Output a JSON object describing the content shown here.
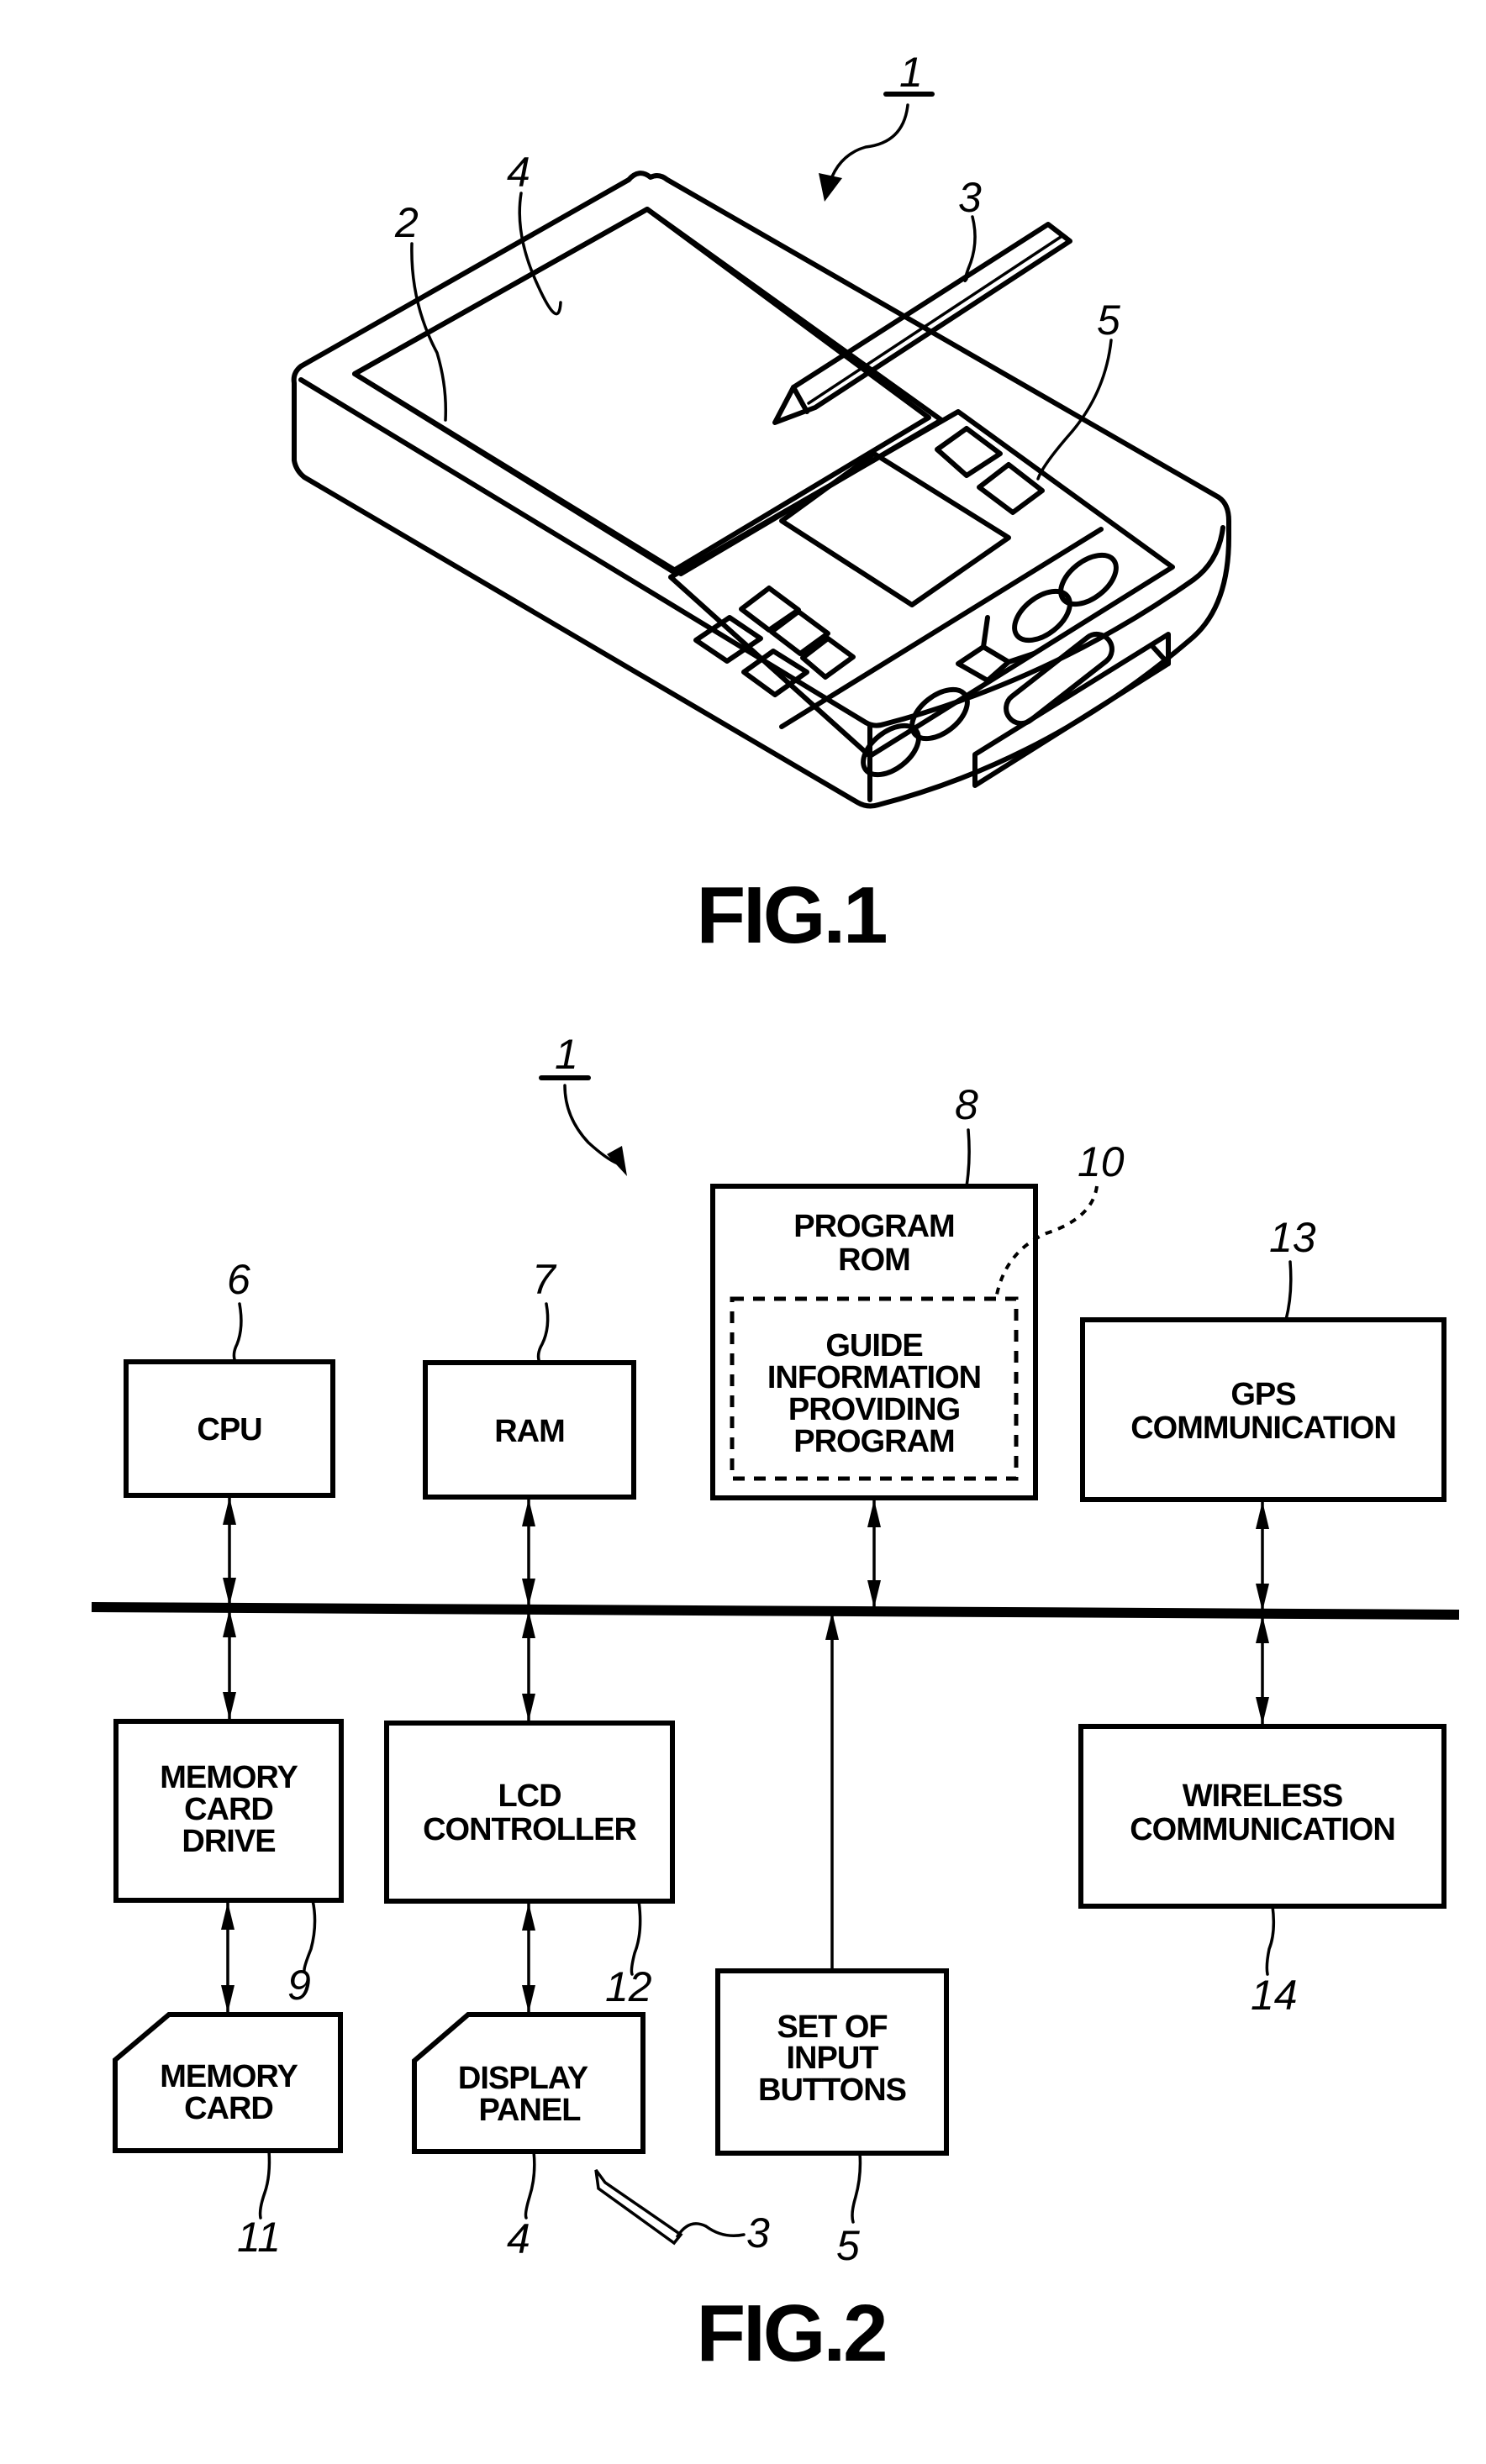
{
  "figures": [
    {
      "caption": "FIG.1",
      "reference_numerals": {
        "device": "1",
        "body": "2",
        "stylus": "3",
        "display": "4",
        "buttons": "5"
      }
    },
    {
      "caption": "FIG.2",
      "device_numeral": "1",
      "blocks": {
        "cpu": {
          "label": [
            "CPU"
          ],
          "numeral": "6"
        },
        "ram": {
          "label": [
            "RAM"
          ],
          "numeral": "7"
        },
        "program_rom": {
          "label": [
            "PROGRAM",
            "ROM"
          ],
          "numeral": "8"
        },
        "guide_program": {
          "label": [
            "GUIDE",
            "INFORMATION",
            "PROVIDING",
            "PROGRAM"
          ],
          "numeral": "10"
        },
        "gps": {
          "label": [
            "GPS",
            "COMMUNICATION"
          ],
          "numeral": "13"
        },
        "memory_card_drive": {
          "label": [
            "MEMORY",
            "CARD",
            "DRIVE"
          ],
          "numeral": "9"
        },
        "lcd_controller": {
          "label": [
            "LCD",
            "CONTROLLER"
          ],
          "numeral": "12"
        },
        "wireless": {
          "label": [
            "WIRELESS",
            "COMMUNICATION"
          ],
          "numeral": "14"
        },
        "memory_card": {
          "label": [
            "MEMORY",
            "CARD"
          ],
          "numeral": "11"
        },
        "display_panel": {
          "label": [
            "DISPLAY",
            "PANEL"
          ],
          "numeral": "4"
        },
        "input_buttons": {
          "label": [
            "SET OF",
            "INPUT",
            "BUTTONS"
          ],
          "numeral": "5"
        },
        "stylus": {
          "numeral": "3"
        }
      }
    }
  ]
}
